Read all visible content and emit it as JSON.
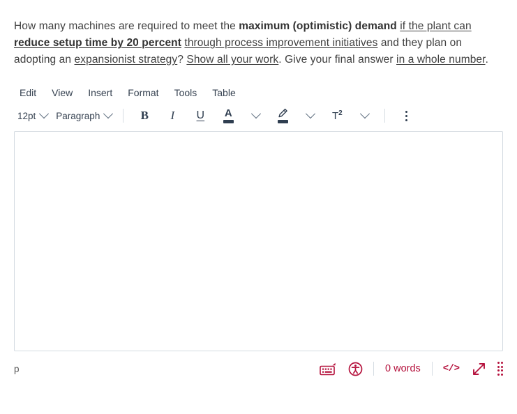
{
  "question": {
    "segments": [
      {
        "text": "How many machines are required to meet the ",
        "style": "plain"
      },
      {
        "text": "maximum (optimistic) demand",
        "style": "bold"
      },
      {
        "text": " ",
        "style": "plain"
      },
      {
        "text": "if the plant can ",
        "style": "underline"
      },
      {
        "text": "reduce setup time by 20 percent",
        "style": "bold-underline"
      },
      {
        "text": " ",
        "style": "plain"
      },
      {
        "text": "through process improvement initiatives",
        "style": "underline"
      },
      {
        "text": " and they plan on adopting an ",
        "style": "plain"
      },
      {
        "text": "expansionist strategy",
        "style": "underline"
      },
      {
        "text": "? ",
        "style": "plain"
      },
      {
        "text": "Show all your work",
        "style": "underline"
      },
      {
        "text": ". Give your final answer ",
        "style": "plain"
      },
      {
        "text": "in a whole number",
        "style": "underline"
      },
      {
        "text": ".",
        "style": "plain"
      }
    ]
  },
  "menubar": {
    "items": [
      {
        "label": "Edit"
      },
      {
        "label": "View"
      },
      {
        "label": "Insert"
      },
      {
        "label": "Format"
      },
      {
        "label": "Tools"
      },
      {
        "label": "Table"
      }
    ]
  },
  "toolbar": {
    "fontsize_label": "12pt",
    "blockformat_label": "Paragraph",
    "bold_label": "B",
    "italic_label": "I",
    "underline_label": "U",
    "textcolor_label": "A",
    "textcolor_swatch": "#2f3e50",
    "highlight_swatch": "#2f3e50",
    "superscript_label": "T",
    "superscript_exponent": "2",
    "more_label": "More"
  },
  "editor": {
    "content": "",
    "placeholder": ""
  },
  "statusbar": {
    "elementpath": "p",
    "wordcount": "0 words",
    "codeview_label": "</>",
    "keyboard_icon": "on-screen-keyboard-icon",
    "accessibility_icon": "accessibility-icon",
    "fullscreen_icon": "fullscreen-icon",
    "resize_icon": "resize-grip-icon",
    "accent_color": "#b5123d"
  }
}
